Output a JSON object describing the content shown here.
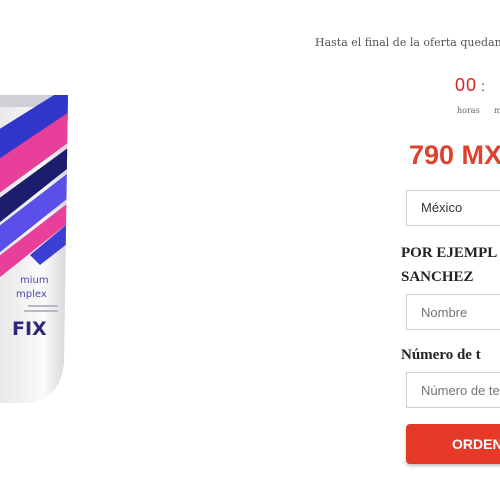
{
  "offer": {
    "text": "Hasta el final de la oferta quedan"
  },
  "countdown": {
    "hours_value": "00",
    "separator": ":",
    "hours_label": "horas",
    "next_label": "m"
  },
  "price": {
    "text": "790 MX"
  },
  "form": {
    "country_value": "México",
    "name_example_line1": "POR EJEMPL",
    "name_example_line2": "SANCHEZ",
    "name_placeholder": "Nombre",
    "phone_label": "Número de t",
    "phone_placeholder": "Número de te",
    "order_label": "ORDEN"
  },
  "product": {
    "label_line1": "mium",
    "label_line2": "mplex",
    "brand_fragment": "FIX",
    "colors": {
      "blue": "#3b3fd4",
      "pink": "#e8409a",
      "navy": "#1d1d6e",
      "silver": "#dedede"
    }
  },
  "colors": {
    "accent": "#e53a28",
    "price": "#e0402e",
    "timer": "#e02020"
  }
}
